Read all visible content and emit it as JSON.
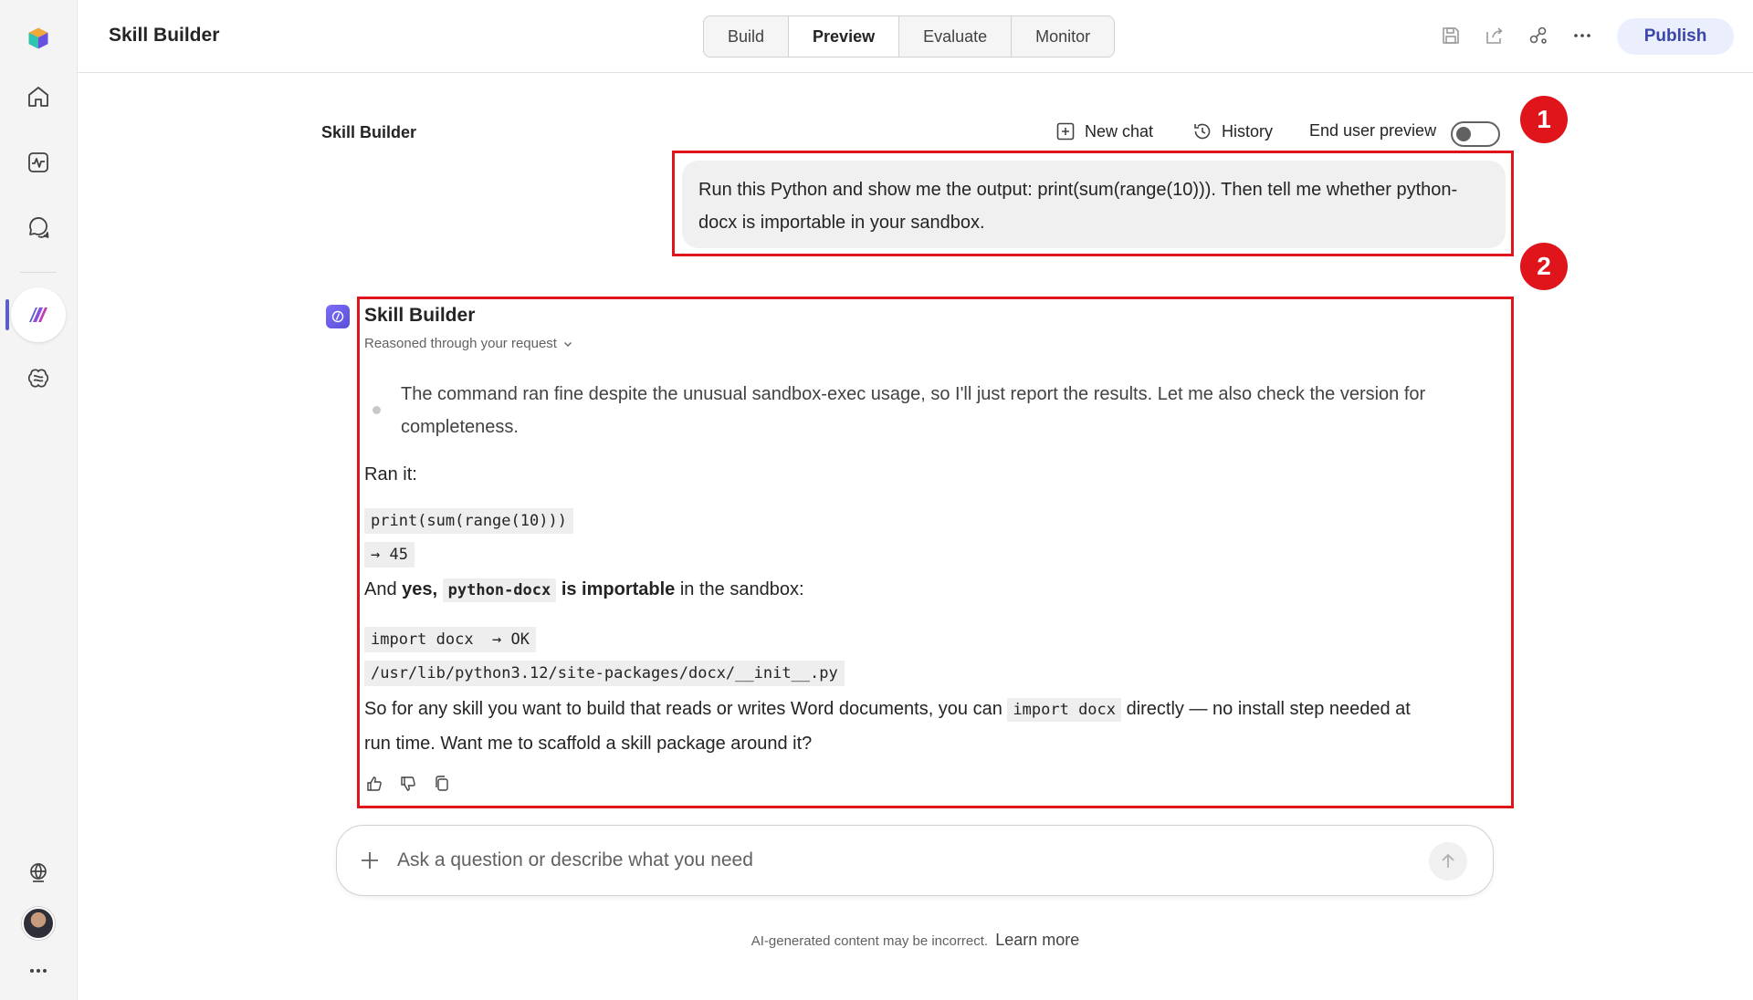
{
  "header": {
    "title": "Skill Builder",
    "tabs": [
      {
        "label": "Build",
        "active": false
      },
      {
        "label": "Preview",
        "active": true
      },
      {
        "label": "Evaluate",
        "active": false
      },
      {
        "label": "Monitor",
        "active": false
      }
    ],
    "publish_label": "Publish",
    "icons": [
      "save-icon",
      "share-icon",
      "connections-icon",
      "more-icon"
    ]
  },
  "rail": {
    "icons": [
      "app-logo-icon",
      "home-icon",
      "activity-icon",
      "chat-icon",
      "agent-icon",
      "brain-icon",
      "globe-icon",
      "avatar",
      "more-icon"
    ]
  },
  "chat": {
    "title": "Skill Builder",
    "new_chat": "New chat",
    "history": "History",
    "end_user_preview": "End user preview",
    "end_user_preview_on": false,
    "user_message": "Run this Python and show me the output: print(sum(range(10))). Then tell me whether python-docx is importable in your sandbox.",
    "bot": {
      "name": "Skill Builder",
      "reasoned": "Reasoned through your request",
      "reasoning": "The command ran fine despite the unusual sandbox-exec usage, so I'll just report the results. Let me also check the version for completeness.",
      "ran_it": "Ran it:",
      "code1": "print(sum(range(10)))",
      "code1_out": "→ 45",
      "and_prefix": "And ",
      "yes": "yes,",
      "pkg": "python-docx",
      "is_importable": "is importable",
      "in_sandbox": " in the sandbox:",
      "code2": "import docx  → OK",
      "code2_path": "/usr/lib/python3.12/site-packages/docx/__init__.py",
      "closing_a": "So for any skill you want to build that reads or writes Word documents, you can ",
      "closing_code": "import docx",
      "closing_b": " directly — no install step needed at",
      "closing_c": "run time. Want me to scaffold a skill package around it?"
    }
  },
  "annotations": {
    "badge1": "1",
    "badge2": "2",
    "color": "#e0151c"
  },
  "composer": {
    "placeholder": "Ask a question or describe what you need"
  },
  "footer": {
    "disclaimer": "AI-generated content may be incorrect.",
    "learn_more": "Learn more"
  },
  "colors": {
    "accent": "#5b5fc7",
    "publish_bg": "#ebeefc",
    "publish_text": "#3b47a8"
  }
}
